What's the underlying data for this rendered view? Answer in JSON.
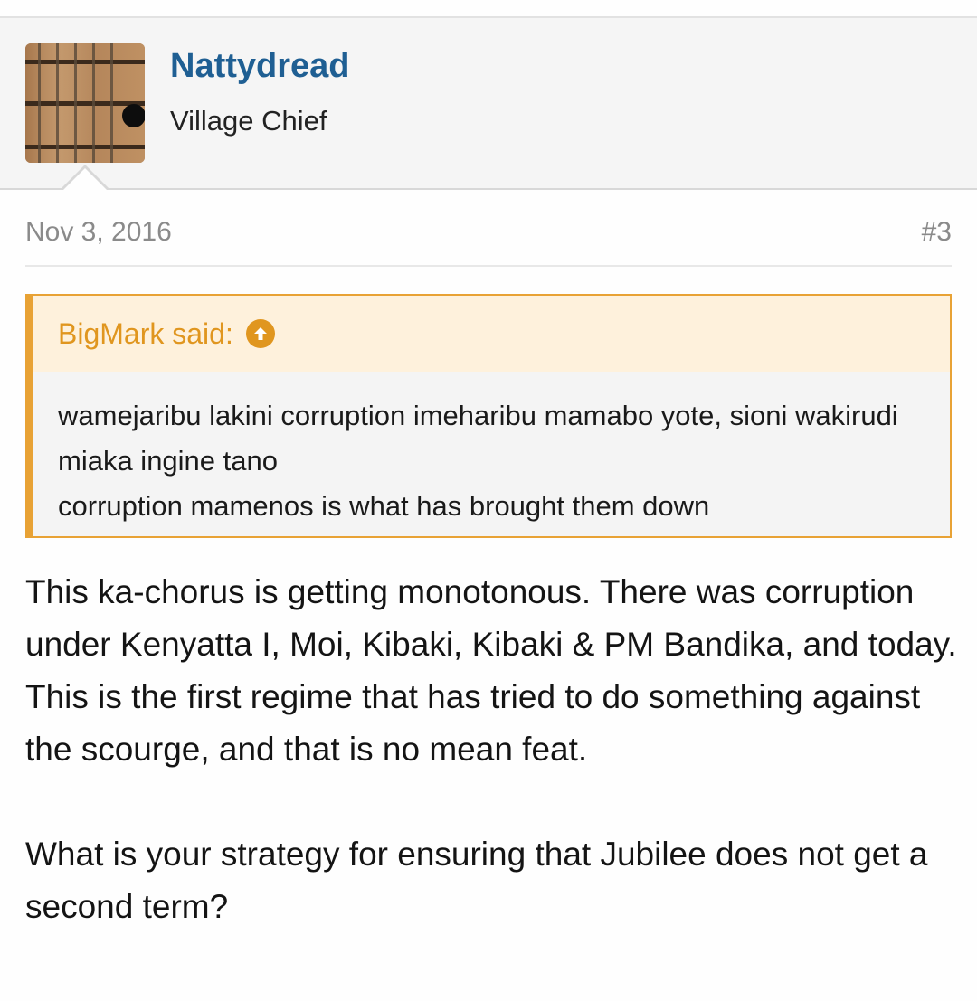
{
  "post": {
    "author": {
      "name": "Nattydread",
      "title": "Village Chief",
      "avatar": "guitar-fretboard-avatar"
    },
    "date": "Nov 3, 2016",
    "number": "#3",
    "quote": {
      "author": "BigMark said:",
      "icon": "arrow-up-circle-icon",
      "lines": [
        "wamejaribu lakini corruption imeharibu mamabo yote, sioni wakirudi miaka ingine tano",
        "corruption mamenos is what has brought them down"
      ]
    },
    "body": [
      "This ka-chorus is getting monotonous. There was corruption under Kenyatta I, Moi, Kibaki, Kibaki & PM Bandika, and today. This is the first regime that has tried to do something against the scourge, and that is no mean feat.",
      "What is your strategy for ensuring that Jubilee does not get a second term?"
    ]
  },
  "colors": {
    "username": "#1f5f93",
    "quote_accent": "#e8a235",
    "quote_header_bg": "#fef1dc",
    "meta_text": "#8a8a8a"
  }
}
